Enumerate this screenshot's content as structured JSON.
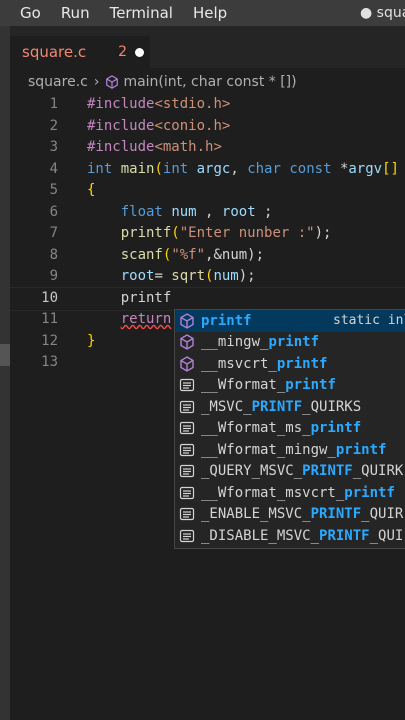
{
  "menubar": {
    "items": [
      "Go",
      "Run",
      "Terminal",
      "Help"
    ],
    "title": "● square"
  },
  "tab": {
    "name": "square.c",
    "problems": "2"
  },
  "breadcrumb": {
    "file": "square.c",
    "symbol": "main(int, char const * [])"
  },
  "editor": {
    "line_numbers": [
      "1",
      "2",
      "3",
      "4",
      "5",
      "6",
      "7",
      "8",
      "9",
      "10",
      "11",
      "12",
      "13"
    ],
    "active_line": "10",
    "lines": {
      "l1_directive": "#include",
      "l1_header": "<stdio.h>",
      "l2_directive": "#include",
      "l2_header": "<conio.h>",
      "l3_directive": "#include",
      "l3_header": "<math.h>",
      "l4_type": "int",
      "l4_fn": "main",
      "l4_open": "(",
      "l4_type2": "int",
      "l4_argc": "argc",
      "l4_comma": ", ",
      "l4_char": "char",
      "l4_const": "const",
      "l4_star": " *",
      "l4_argv": "argv",
      "l4_bracket": "[]",
      "l5": "{",
      "l6_type": "float",
      "l6_rest_a": "num",
      "l6_rest_b": " , ",
      "l6_rest_c": "root",
      "l6_rest_d": " ;",
      "l7_fn": "printf",
      "l7_open": "(",
      "l7_str": "\"Enter nunber :\"",
      "l7_close": ");",
      "l8_fn": "scanf",
      "l8_open": "(",
      "l8_str": "\"%f\"",
      "l8_rest": ",&num);",
      "l9_var": "root",
      "l9_eq": "= ",
      "l9_fn": "sqrt",
      "l9_open": "(",
      "l9_arg": "num",
      "l9_close": ");",
      "l10": "printf",
      "l11_kw": "return",
      "l12": "}"
    }
  },
  "suggestions": [
    {
      "icon": "cube-icon",
      "match": "printf",
      "pre": "",
      "post": "",
      "detail": "static inl",
      "selected": true
    },
    {
      "icon": "cube-icon",
      "pre": "__mingw_",
      "match": "printf",
      "post": ""
    },
    {
      "icon": "cube-icon",
      "pre": "__msvcrt_",
      "match": "printf",
      "post": ""
    },
    {
      "icon": "text-icon",
      "pre": "__Wformat_",
      "match": "printf",
      "post": ""
    },
    {
      "icon": "text-icon",
      "pre": "_MSVC_",
      "match": "PRINTF",
      "post": "_QUIRKS"
    },
    {
      "icon": "text-icon",
      "pre": "__Wformat_ms_",
      "match": "printf",
      "post": ""
    },
    {
      "icon": "text-icon",
      "pre": "__Wformat_mingw_",
      "match": "printf",
      "post": ""
    },
    {
      "icon": "text-icon",
      "pre": "_QUERY_MSVC_",
      "match": "PRINTF",
      "post": "_QUIRK"
    },
    {
      "icon": "text-icon",
      "pre": "__Wformat_msvcrt_",
      "match": "printf",
      "post": ""
    },
    {
      "icon": "text-icon",
      "pre": "_ENABLE_MSVC_",
      "match": "PRINTF",
      "post": "_QUIR"
    },
    {
      "icon": "text-icon",
      "pre": "_DISABLE_MSVC_",
      "match": "PRINTF",
      "post": "_QUI"
    }
  ],
  "colors": {
    "background": "#1e1e1e",
    "match_highlight": "#2aaaff",
    "selected_suggestion": "#04395e",
    "error": "#f48771"
  }
}
